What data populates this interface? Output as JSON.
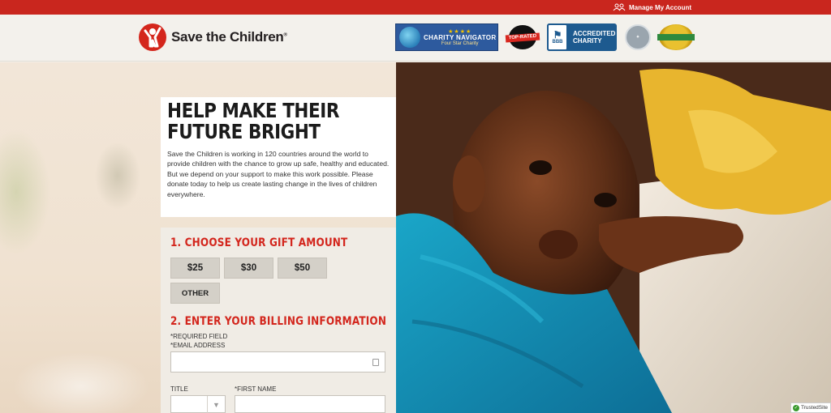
{
  "topbar": {
    "account_label": "Manage My Account"
  },
  "header": {
    "logo_text": "Save the Children",
    "logo_registered": "®",
    "badges": {
      "charity_navigator": {
        "stars": "★★★★",
        "title": "CHARITY NAVIGATOR",
        "subtitle": "Four Star Charity"
      },
      "top_rated": {
        "label": "TOP-RATED"
      },
      "bbb": {
        "mark": "BBB",
        "line1": "ACCREDITED",
        "line2": "CHARITY"
      },
      "seal": {
        "label": ""
      },
      "gold": {
        "label": ""
      }
    }
  },
  "intro": {
    "title": "Help make their future bright",
    "body": "Save the Children is working in 120 countries around the world to provide children with the chance to grow up safe, healthy and educated. But we depend on your support to make this work possible. Please donate today to help us create lasting change in the lives of children everywhere."
  },
  "form": {
    "step1_title": "1. Choose your gift amount",
    "amounts": [
      "$25",
      "$30",
      "$50",
      "OTHER"
    ],
    "step2_title": "2. Enter your billing information",
    "required_note": "*Required field",
    "email_label": "*Email address",
    "email_value": "",
    "title_label": "Title",
    "title_value": "",
    "first_name_label": "*First name",
    "first_name_value": ""
  },
  "trusted_site": {
    "label": "TrustedSite"
  },
  "colors": {
    "brand_red": "#d3261d",
    "topbar_red": "#c9261e",
    "header_bg": "#f3f1ec",
    "form_bg": "#f0ece5"
  }
}
